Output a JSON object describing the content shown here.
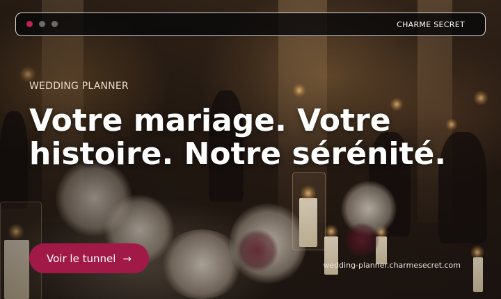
{
  "window": {
    "brand": "CHARME SECRET",
    "controls": [
      {
        "name": "close-dot",
        "color": "#c41f52"
      },
      {
        "name": "minimize-dot",
        "color": "#6b6b6b"
      },
      {
        "name": "maximize-dot",
        "color": "#6b6b6b"
      }
    ]
  },
  "hero": {
    "eyebrow": "WEDDING PLANNER",
    "headline": "Votre mariage. Votre histoire. Notre sérénité.",
    "cta": {
      "label": "Voir le tunnel",
      "icon": "arrow-right-icon",
      "arrow": "→",
      "color": "#a11a47"
    },
    "url": "wedding-planner.charmesecret.com"
  },
  "background": {
    "description_icon": "wedding-reception-photo"
  }
}
